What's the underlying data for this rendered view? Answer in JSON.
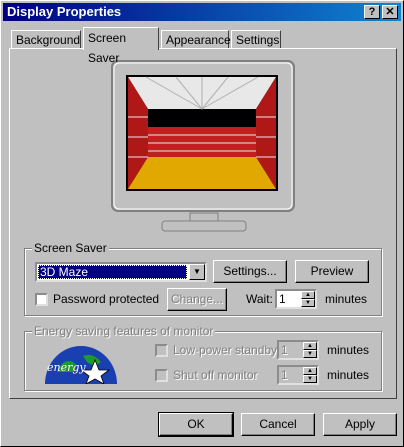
{
  "window": {
    "title": "Display Properties",
    "help_glyph": "?",
    "close_glyph": "✕"
  },
  "tabs": [
    {
      "label": "Background"
    },
    {
      "label": "Screen Saver"
    },
    {
      "label": "Appearance"
    },
    {
      "label": "Settings"
    }
  ],
  "screen_saver": {
    "group_label": "Screen Saver",
    "selected": "3D Maze",
    "settings_label": "Settings...",
    "preview_label": "Preview",
    "password_label": "Password protected",
    "change_label": "Change...",
    "wait_label": "Wait:",
    "wait_value": "1",
    "wait_units": "minutes"
  },
  "energy": {
    "group_label": "Energy saving features of monitor",
    "logo_text": "energy",
    "low_power_label": "Low-power standby",
    "low_power_value": "1",
    "low_power_units": "minutes",
    "shutoff_label": "Shut off monitor",
    "shutoff_value": "1",
    "shutoff_units": "minutes"
  },
  "footer": {
    "ok": "OK",
    "cancel": "Cancel",
    "apply": "Apply"
  },
  "colors": {
    "title_start": "#000080",
    "title_end": "#1084d0",
    "face": "#c0c0c0",
    "brick": "#b01818",
    "floor": "#e0a800"
  }
}
